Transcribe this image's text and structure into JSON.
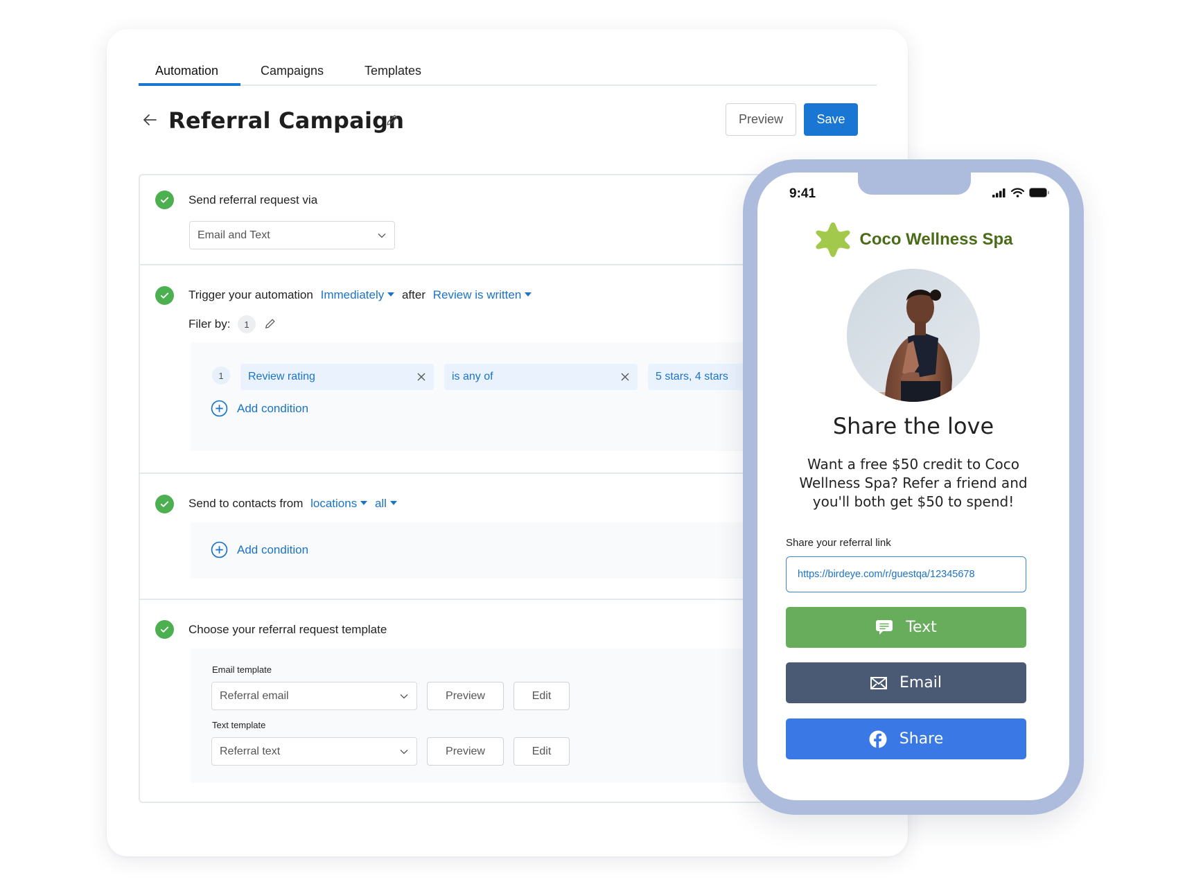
{
  "tabs": [
    {
      "label": "Automation",
      "active": true
    },
    {
      "label": "Campaigns",
      "active": false
    },
    {
      "label": "Templates",
      "active": false
    }
  ],
  "header": {
    "title": "Referral Campaign",
    "preview_label": "Preview",
    "save_label": "Save"
  },
  "colors": {
    "accent": "#1976d2",
    "success": "#4caf50",
    "link": "#1a73c7",
    "phone_frame": "#adbcdc",
    "brand_green": "#4a6b18",
    "text_button": "#67ad5b",
    "email_button": "#4a5a74",
    "share_button": "#3a78e6"
  },
  "steps": {
    "send_via": {
      "label": "Send referral request via",
      "selected": "Email and Text"
    },
    "trigger": {
      "label": "Trigger your automation",
      "timing": "Immediately",
      "after_label": "after",
      "event": "Review is written",
      "filter_label": "Filer by:",
      "filter_count": "1",
      "conditions": [
        {
          "index": "1",
          "field": "Review rating",
          "operator": "is any of",
          "value": "5 stars, 4 stars"
        }
      ],
      "add_condition": "Add condition"
    },
    "contacts": {
      "label": "Send to contacts from",
      "source": "locations",
      "scope": "all",
      "add_condition": "Add condition"
    },
    "template": {
      "label": "Choose your referral request template",
      "email_label": "Email template",
      "email_selected": "Referral email",
      "text_label": "Text template",
      "text_selected": "Referral text",
      "preview_label": "Preview",
      "edit_label": "Edit"
    }
  },
  "phone": {
    "time": "9:41",
    "brand_name": "Coco Wellness Spa",
    "heading": "Share the love",
    "description": "Want a free $50 credit to Coco Wellness Spa? Refer a friend and you'll both get $50 to spend!",
    "link_label": "Share your referral link",
    "link_value": "https://birdeye.com/r/guestqa/12345678",
    "buttons": {
      "text": "Text",
      "email": "Email",
      "share": "Share"
    }
  }
}
